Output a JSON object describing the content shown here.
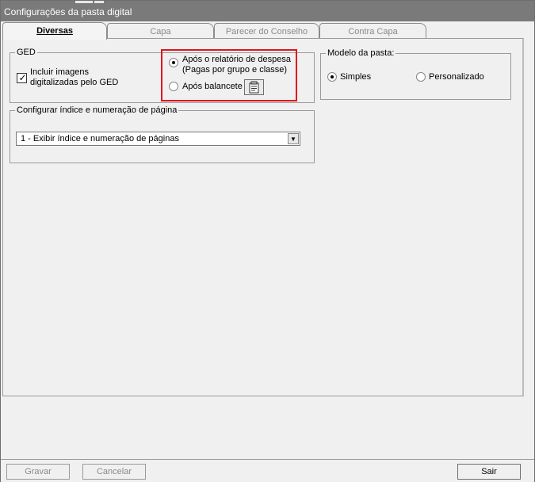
{
  "window": {
    "title": "Configurações da pasta digital"
  },
  "tabs": [
    {
      "label": "Diversas",
      "active": true
    },
    {
      "label": "Capa",
      "active": false
    },
    {
      "label": "Parecer do Conselho",
      "active": false
    },
    {
      "label": "Contra Capa",
      "active": false
    }
  ],
  "ged": {
    "legend": "GED",
    "include_images": {
      "label_line1": "Incluir imagens",
      "label_line2": "digitalizadas pelo GED",
      "checked": true
    },
    "option_expense": {
      "label_line1": "Após o relatório de despesa",
      "label_line2": "(Pagas por grupo e classe)",
      "selected": true
    },
    "option_balance": {
      "label": "Após balancete",
      "selected": false,
      "icon": "properties-icon"
    }
  },
  "folder_model": {
    "legend": "Modelo da pasta:",
    "options": [
      {
        "label": "Simples",
        "selected": true
      },
      {
        "label": "Personalizado",
        "selected": false
      }
    ]
  },
  "index_config": {
    "legend": "Configurar índice e numeração de página",
    "selected_value": "1 - Exibir índice e numeração de páginas"
  },
  "buttons": {
    "save": {
      "label": "Gravar",
      "enabled": false
    },
    "cancel": {
      "label": "Cancelar",
      "enabled": false
    },
    "exit": {
      "label": "Sair",
      "enabled": true
    }
  },
  "colors": {
    "highlight": "#e0141e",
    "titlebar": "#7a7a7a"
  }
}
